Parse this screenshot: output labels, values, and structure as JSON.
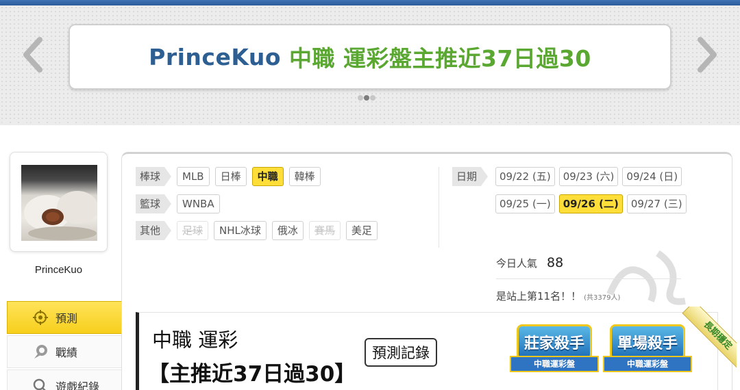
{
  "banner": {
    "name": "PrinceKuo",
    "text": "中職 運彩盤主推近37日過30",
    "dots": 3,
    "active_dot": 1
  },
  "profile": {
    "username": "PrinceKuo"
  },
  "menu": {
    "items": [
      {
        "label": "預測",
        "active": true
      },
      {
        "label": "戰績",
        "active": false
      },
      {
        "label": "遊戲紀錄",
        "active": false
      }
    ]
  },
  "categories": {
    "baseball": {
      "label": "棒球",
      "tags": [
        "MLB",
        "日棒",
        "中職",
        "韓棒"
      ],
      "active": "中職"
    },
    "basketball": {
      "label": "籃球",
      "tags": [
        "WNBA"
      ]
    },
    "other": {
      "label": "其他",
      "tags": [
        "足球",
        "NHL冰球",
        "俄冰",
        "賽馬",
        "美足"
      ],
      "disabled": [
        "足球",
        "賽馬"
      ]
    }
  },
  "dates": {
    "label": "日期",
    "row1": [
      "09/22 (五)",
      "09/23 (六)",
      "09/24 (日)"
    ],
    "row2": [
      "09/25 (一)",
      "09/26 (二)",
      "09/27 (三)"
    ],
    "active": "09/26 (二)"
  },
  "popularity": {
    "label": "今日人氣",
    "value": "88",
    "rank": "是站上第11名！！",
    "rank_sub": "(共3379人)"
  },
  "prediction": {
    "league": "中職 運彩",
    "title": "【主推近37日過30】",
    "record_button": "預測記錄",
    "badges": [
      {
        "title": "莊家殺手",
        "subtitle": "中職運彩盤"
      },
      {
        "title": "單場殺手",
        "subtitle": "中職運彩盤"
      }
    ],
    "ribbon": "長期穩定"
  },
  "colors": {
    "accent_yellow": "#ffde3a",
    "brand_blue": "#2d5f92",
    "brand_green": "#5aa732",
    "top_bar": "#3f72b4"
  }
}
